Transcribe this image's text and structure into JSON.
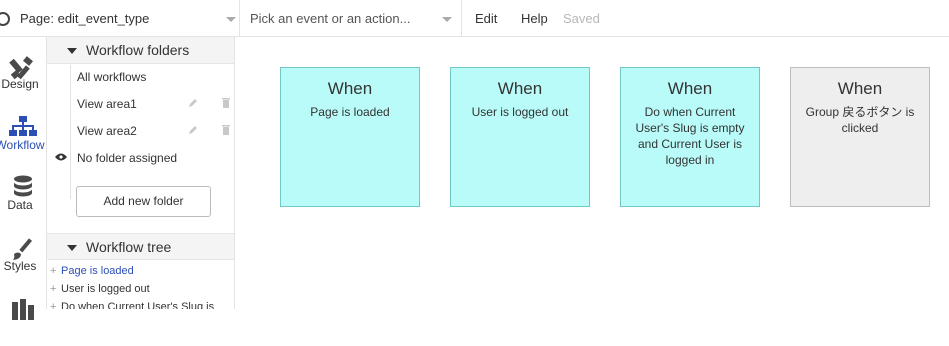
{
  "topbar": {
    "page_select": "Page: edit_event_type",
    "action_placeholder": "Pick an event or an action...",
    "edit": "Edit",
    "help": "Help",
    "saved": "Saved"
  },
  "rail": {
    "design": "Design",
    "workflow": "Workflow",
    "data": "Data",
    "styles": "Styles"
  },
  "sidebar": {
    "folders_heading": "Workflow folders",
    "folders": [
      {
        "label": "All workflows"
      },
      {
        "label": "View area1"
      },
      {
        "label": "View area2"
      },
      {
        "label": "No folder assigned"
      }
    ],
    "add_folder": "Add new folder",
    "tree_heading": "Workflow tree",
    "tree": [
      {
        "label": "Page is loaded"
      },
      {
        "label": "User is logged out"
      },
      {
        "label": "Do when Current User's Slug is"
      }
    ]
  },
  "canvas": {
    "cards": [
      {
        "when": "When",
        "event": "Page is loaded"
      },
      {
        "when": "When",
        "event": "User is logged out"
      },
      {
        "when": "When",
        "event": "Do when Current User's Slug is empty and Current User is logged in"
      },
      {
        "when": "When",
        "event": "Group 戻るボタン is clicked"
      }
    ]
  },
  "colors": {
    "accent": "#2c4fb6",
    "card_fill": "#b9fbf8",
    "card_border": "#74c8c4",
    "card_grey_fill": "#eeeeee"
  }
}
